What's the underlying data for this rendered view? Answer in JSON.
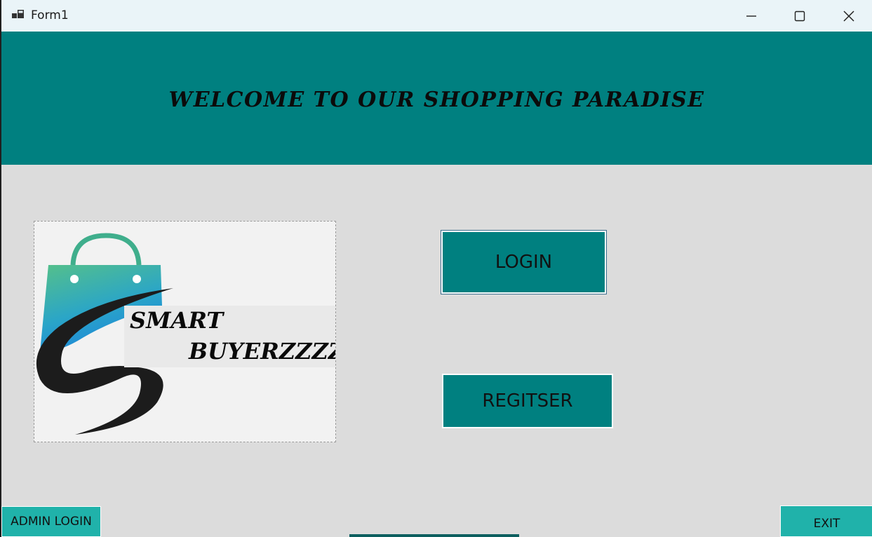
{
  "window": {
    "title": "Form1",
    "controls": {
      "minimize": "minimize-icon",
      "maximize": "maximize-icon",
      "close": "close-icon"
    }
  },
  "banner": {
    "title": "WELCOME TO OUR SHOPPING PARADISE"
  },
  "logo": {
    "line1": "SMART",
    "line2": "BUYERZZZZ"
  },
  "buttons": {
    "login": "LOGIN",
    "register": "REGITSER",
    "admin_login": "ADMIN LOGIN",
    "exit": "EXIT"
  },
  "colors": {
    "banner": "#008080",
    "button": "#008080",
    "small_button": "#20b2aa",
    "background": "#dcdcdc"
  }
}
